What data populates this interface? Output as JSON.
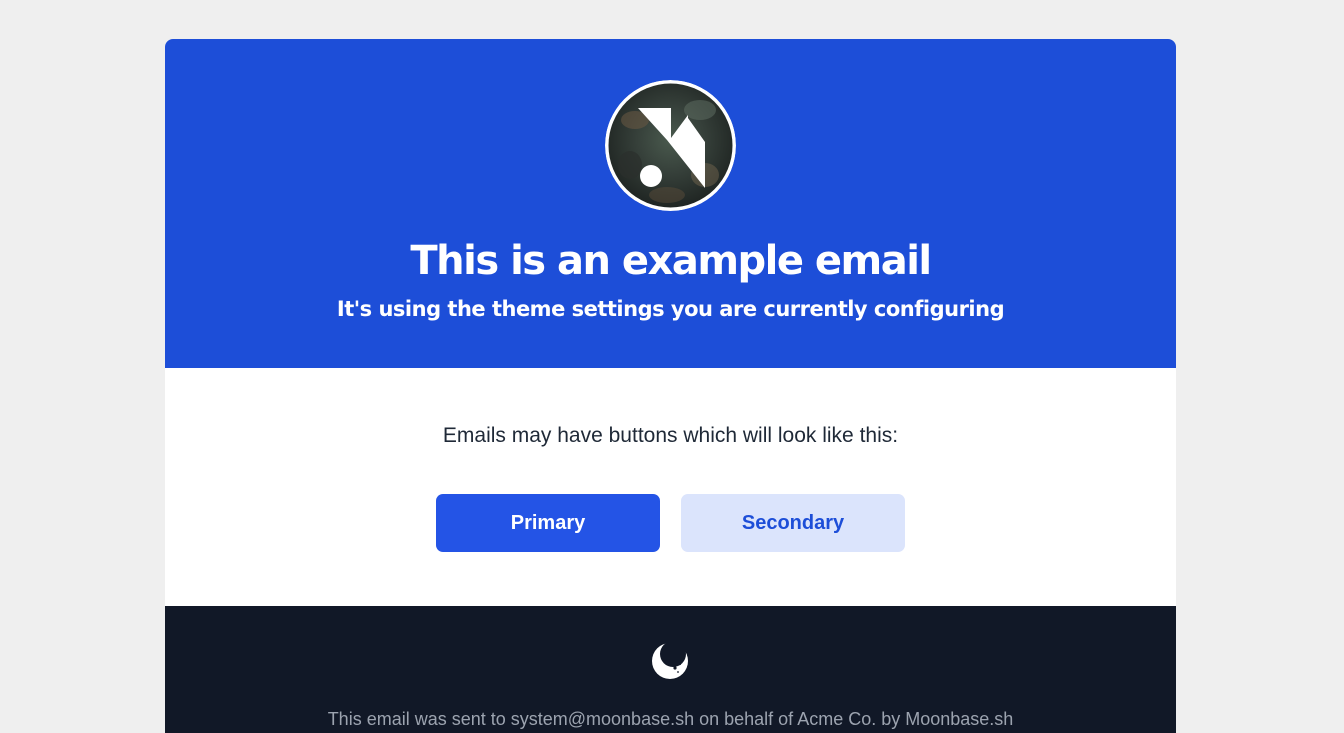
{
  "header": {
    "background_color": "#1d4ed8",
    "logo_icon": "brand-logo-icon",
    "title": "This is an example email",
    "subtitle": "It's using the theme settings you are currently configuring"
  },
  "body": {
    "intro_text": "Emails may have buttons which will look like this:",
    "primary_button_label": "Primary",
    "secondary_button_label": "Secondary",
    "primary_color": "#2454e6",
    "secondary_color": "#dbe4fc"
  },
  "footer": {
    "background_color": "#111827",
    "icon": "moon-icon",
    "text": "This email was sent to system@moonbase.sh on behalf of Acme Co. by Moonbase.sh"
  }
}
